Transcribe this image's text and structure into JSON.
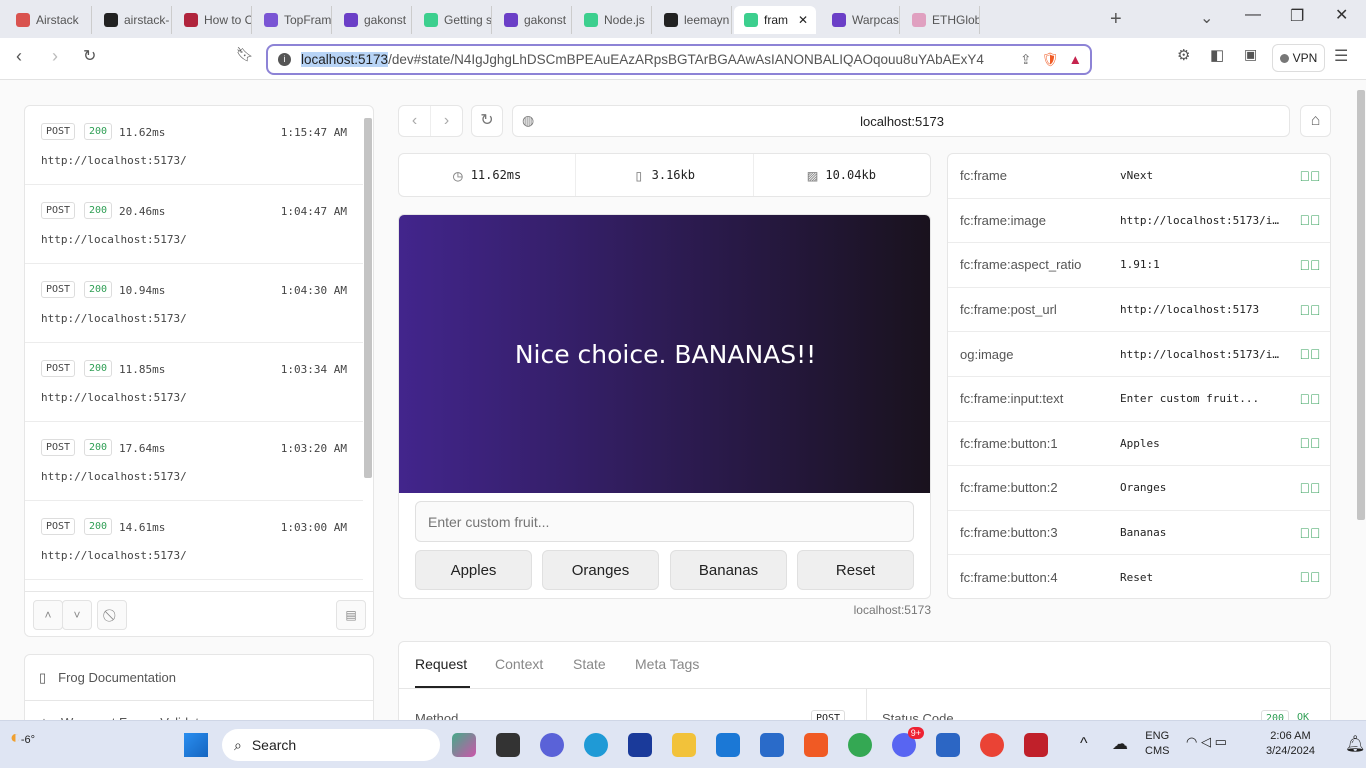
{
  "browser": {
    "tabs": [
      {
        "title": "Airstack",
        "color": "#d9534f"
      },
      {
        "title": "airstack-",
        "color": "#222"
      },
      {
        "title": "How to C",
        "color": "#b0243c"
      },
      {
        "title": "TopFram",
        "color": "#7a55d4"
      },
      {
        "title": "gakonst",
        "color": "#6b3fc7"
      },
      {
        "title": "Getting s",
        "color": "#3ccf8e"
      },
      {
        "title": "gakonst",
        "color": "#6b3fc7"
      },
      {
        "title": "Node.js",
        "color": "#3ccf8e"
      },
      {
        "title": "leemayn",
        "color": "#222"
      },
      {
        "title": "fram",
        "color": "#3ccf8e",
        "active": true
      },
      {
        "title": "Warpcas",
        "color": "#6b3fc7"
      },
      {
        "title": "ETHGlob",
        "color": "#e0a0c0"
      }
    ],
    "url_host": "localhost:5173",
    "url_rest": "/dev#state/N4IgJghgLhDSCmBPEAuEAzARpsBGTArBGAAwAsIANONBALIQAOqouu8uYAbAExY4",
    "vpn": "VPN"
  },
  "requests": [
    {
      "method": "POST",
      "status": "200",
      "time": "11.62ms",
      "at": "1:15:47 AM",
      "url": "http://localhost:5173/"
    },
    {
      "method": "POST",
      "status": "200",
      "time": "20.46ms",
      "at": "1:04:47 AM",
      "url": "http://localhost:5173/"
    },
    {
      "method": "POST",
      "status": "200",
      "time": "10.94ms",
      "at": "1:04:30 AM",
      "url": "http://localhost:5173/"
    },
    {
      "method": "POST",
      "status": "200",
      "time": "11.85ms",
      "at": "1:03:34 AM",
      "url": "http://localhost:5173/"
    },
    {
      "method": "POST",
      "status": "200",
      "time": "17.64ms",
      "at": "1:03:20 AM",
      "url": "http://localhost:5173/"
    },
    {
      "method": "POST",
      "status": "200",
      "time": "14.61ms",
      "at": "1:03:00 AM",
      "url": "http://localhost:5173/"
    }
  ],
  "links": {
    "docs": "Frog Documentation",
    "validator": "Warpcast Frame Validator"
  },
  "frame": {
    "address": "localhost:5173",
    "stats": {
      "time": "11.62ms",
      "size": "3.16kb",
      "image_size": "10.04kb"
    },
    "image_text": "Nice choice. BANANAS!!",
    "input_placeholder": "Enter custom fruit...",
    "buttons": [
      "Apples",
      "Oranges",
      "Bananas",
      "Reset"
    ],
    "footer": "localhost:5173",
    "gradient": [
      "#42258c",
      "#19121d"
    ]
  },
  "meta_tags": [
    {
      "k": "fc:frame",
      "v": "vNext"
    },
    {
      "k": "fc:frame:image",
      "v": "http://localhost:5173/i…"
    },
    {
      "k": "fc:frame:aspect_ratio",
      "v": "1.91:1"
    },
    {
      "k": "fc:frame:post_url",
      "v": "http://localhost:5173"
    },
    {
      "k": "og:image",
      "v": "http://localhost:5173/i…"
    },
    {
      "k": "fc:frame:input:text",
      "v": "Enter custom fruit..."
    },
    {
      "k": "fc:frame:button:1",
      "v": "Apples"
    },
    {
      "k": "fc:frame:button:2",
      "v": "Oranges"
    },
    {
      "k": "fc:frame:button:3",
      "v": "Bananas"
    },
    {
      "k": "fc:frame:button:4",
      "v": "Reset"
    }
  ],
  "bottom": {
    "tabs": [
      "Request",
      "Context",
      "State",
      "Meta Tags"
    ],
    "method_label": "Method",
    "method": "POST",
    "status_label": "Status Code",
    "status": "200",
    "status_text": "OK"
  },
  "taskbar": {
    "weather": "-6°",
    "search": "Search",
    "lang1": "ENG",
    "lang2": "CMS",
    "time": "2:06 AM",
    "date": "3/24/2024",
    "discord_badge": "9+"
  }
}
